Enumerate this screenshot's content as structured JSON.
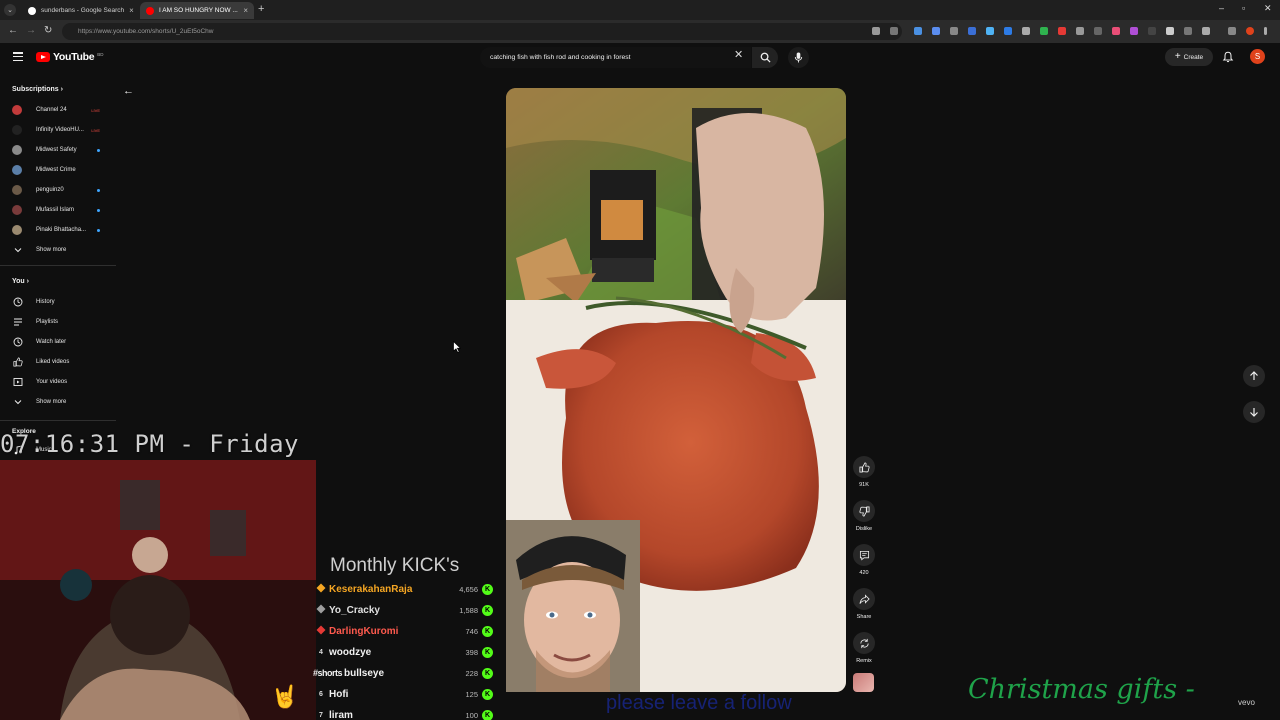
{
  "browser": {
    "tabs": [
      {
        "title": "sunderbans - Google Search",
        "favicon_color": "#ffffff",
        "active": false
      },
      {
        "title": "I AM SO HUNGRY NOW ...",
        "favicon_color": "#ff0000",
        "active": true
      }
    ],
    "url": "https://www.youtube.com/shorts/U_2uEt5oChw",
    "new_tab_symbol": "+",
    "close_symbol": "×"
  },
  "masthead": {
    "logo_text": "YouTube",
    "country_code": "BD",
    "search_value": "catching fish with fish rod and cooking in forest",
    "create_label": "Create",
    "avatar_letter": "S"
  },
  "sidebar": {
    "subscriptions_label": "Subscriptions",
    "subscriptions": [
      {
        "name": "Channel 24",
        "avatar_color": "#c23b3b",
        "indicator": "live"
      },
      {
        "name": "Infinity VideoHU...",
        "avatar_color": "#222222",
        "indicator": "live"
      },
      {
        "name": "Midwest Safety",
        "avatar_color": "#8a8a8a",
        "indicator": "dot"
      },
      {
        "name": "Midwest Crime",
        "avatar_color": "#5b7fa8",
        "indicator": "none"
      },
      {
        "name": "penguinz0",
        "avatar_color": "#6b5a48",
        "indicator": "dot"
      },
      {
        "name": "Mufassil Islam",
        "avatar_color": "#7a3b3b",
        "indicator": "dot"
      },
      {
        "name": "Pinaki Bhattacha...",
        "avatar_color": "#9b8a70",
        "indicator": "dot"
      }
    ],
    "live_label": "LIVE",
    "show_more_1": "Show more",
    "you_label": "You",
    "you_items": [
      {
        "label": "History",
        "icon": "history-icon"
      },
      {
        "label": "Playlists",
        "icon": "playlists-icon"
      },
      {
        "label": "Watch later",
        "icon": "watch-later-icon"
      },
      {
        "label": "Liked videos",
        "icon": "liked-icon"
      },
      {
        "label": "Your videos",
        "icon": "your-videos-icon"
      }
    ],
    "show_more_2": "Show more",
    "explore_label": "Explore",
    "explore_items": [
      {
        "label": "Music",
        "icon": "music-icon"
      }
    ]
  },
  "short": {
    "actions": [
      {
        "id": "like",
        "label": "91K",
        "icon": "thumbs-up-icon"
      },
      {
        "id": "dislike",
        "label": "Dislike",
        "icon": "thumbs-down-icon"
      },
      {
        "id": "comments",
        "label": "420",
        "icon": "comment-icon"
      },
      {
        "id": "share",
        "label": "Share",
        "icon": "share-icon"
      },
      {
        "id": "remix",
        "label": "Remix",
        "icon": "remix-icon"
      }
    ]
  },
  "overlay": {
    "clock": "07:16:31 PM - Friday",
    "kick_title": "Monthly KICK's",
    "leaderboard": [
      {
        "rank": "",
        "badge": "#f5a623",
        "name": "KeserakahanRaja",
        "amount": "4,656",
        "name_color": "#f5a623"
      },
      {
        "rank": "",
        "badge": "#9e9e9e",
        "name": "Yo_Cracky",
        "amount": "1,588",
        "name_color": "#e0e0e0"
      },
      {
        "rank": "",
        "badge": "#e53935",
        "name": "DarlingKuromi",
        "amount": "746",
        "name_color": "#ff5a4e"
      },
      {
        "rank": "4",
        "badge": "",
        "name": "woodzye",
        "amount": "398",
        "name_color": "#f1f1f1"
      },
      {
        "rank": "#shorts",
        "badge": "",
        "name": "bullseye",
        "amount": "228",
        "name_color": "#f1f1f1"
      },
      {
        "rank": "6",
        "badge": "",
        "name": "Hofi",
        "amount": "125",
        "name_color": "#f1f1f1"
      },
      {
        "rank": "7",
        "badge": "",
        "name": "liram",
        "amount": "100",
        "name_color": "#f1f1f1"
      }
    ],
    "ticker": "please leave a follow",
    "christmas": "Christmas gifts -",
    "corner_logo": "vevo"
  }
}
